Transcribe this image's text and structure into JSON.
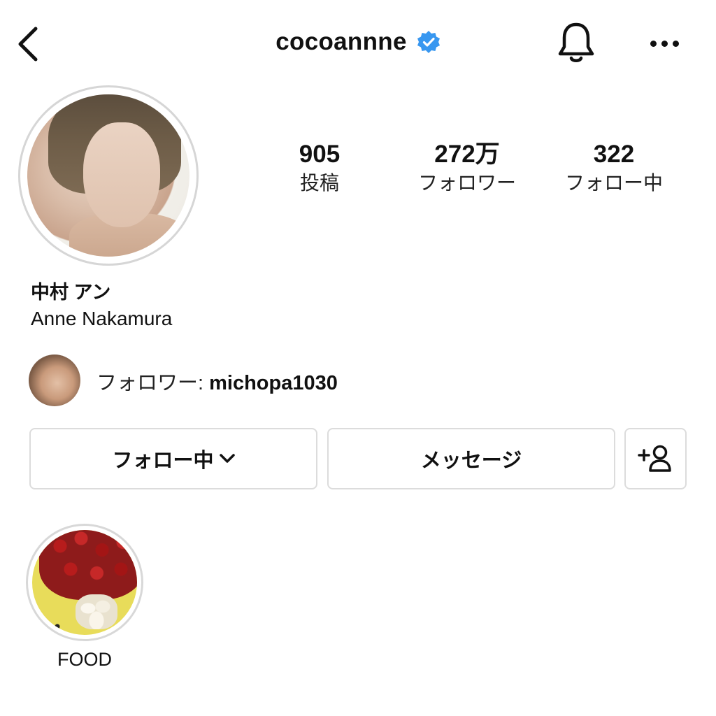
{
  "header": {
    "username": "cocoannne",
    "icons": {
      "back": "chevron-left-icon",
      "verified": "verified-badge-icon",
      "notifications": "bell-icon",
      "more": "more-horizontal-icon"
    },
    "verified_color": "#3897f0"
  },
  "profile": {
    "stats": [
      {
        "value": "905",
        "label": "投稿"
      },
      {
        "value": "272万",
        "label": "フォロワー"
      },
      {
        "value": "322",
        "label": "フォロー中"
      }
    ],
    "name_jp": "中村 アン",
    "name_en": "Anne Nakamura",
    "followed_by": {
      "label": "フォロワー: ",
      "username": "michopa1030"
    }
  },
  "actions": {
    "following_label": "フォロー中",
    "message_label": "メッセージ",
    "icons": {
      "following_dropdown": "chevron-down-icon",
      "add_user": "add-user-icon"
    }
  },
  "highlights": [
    {
      "label": "FOOD"
    }
  ]
}
